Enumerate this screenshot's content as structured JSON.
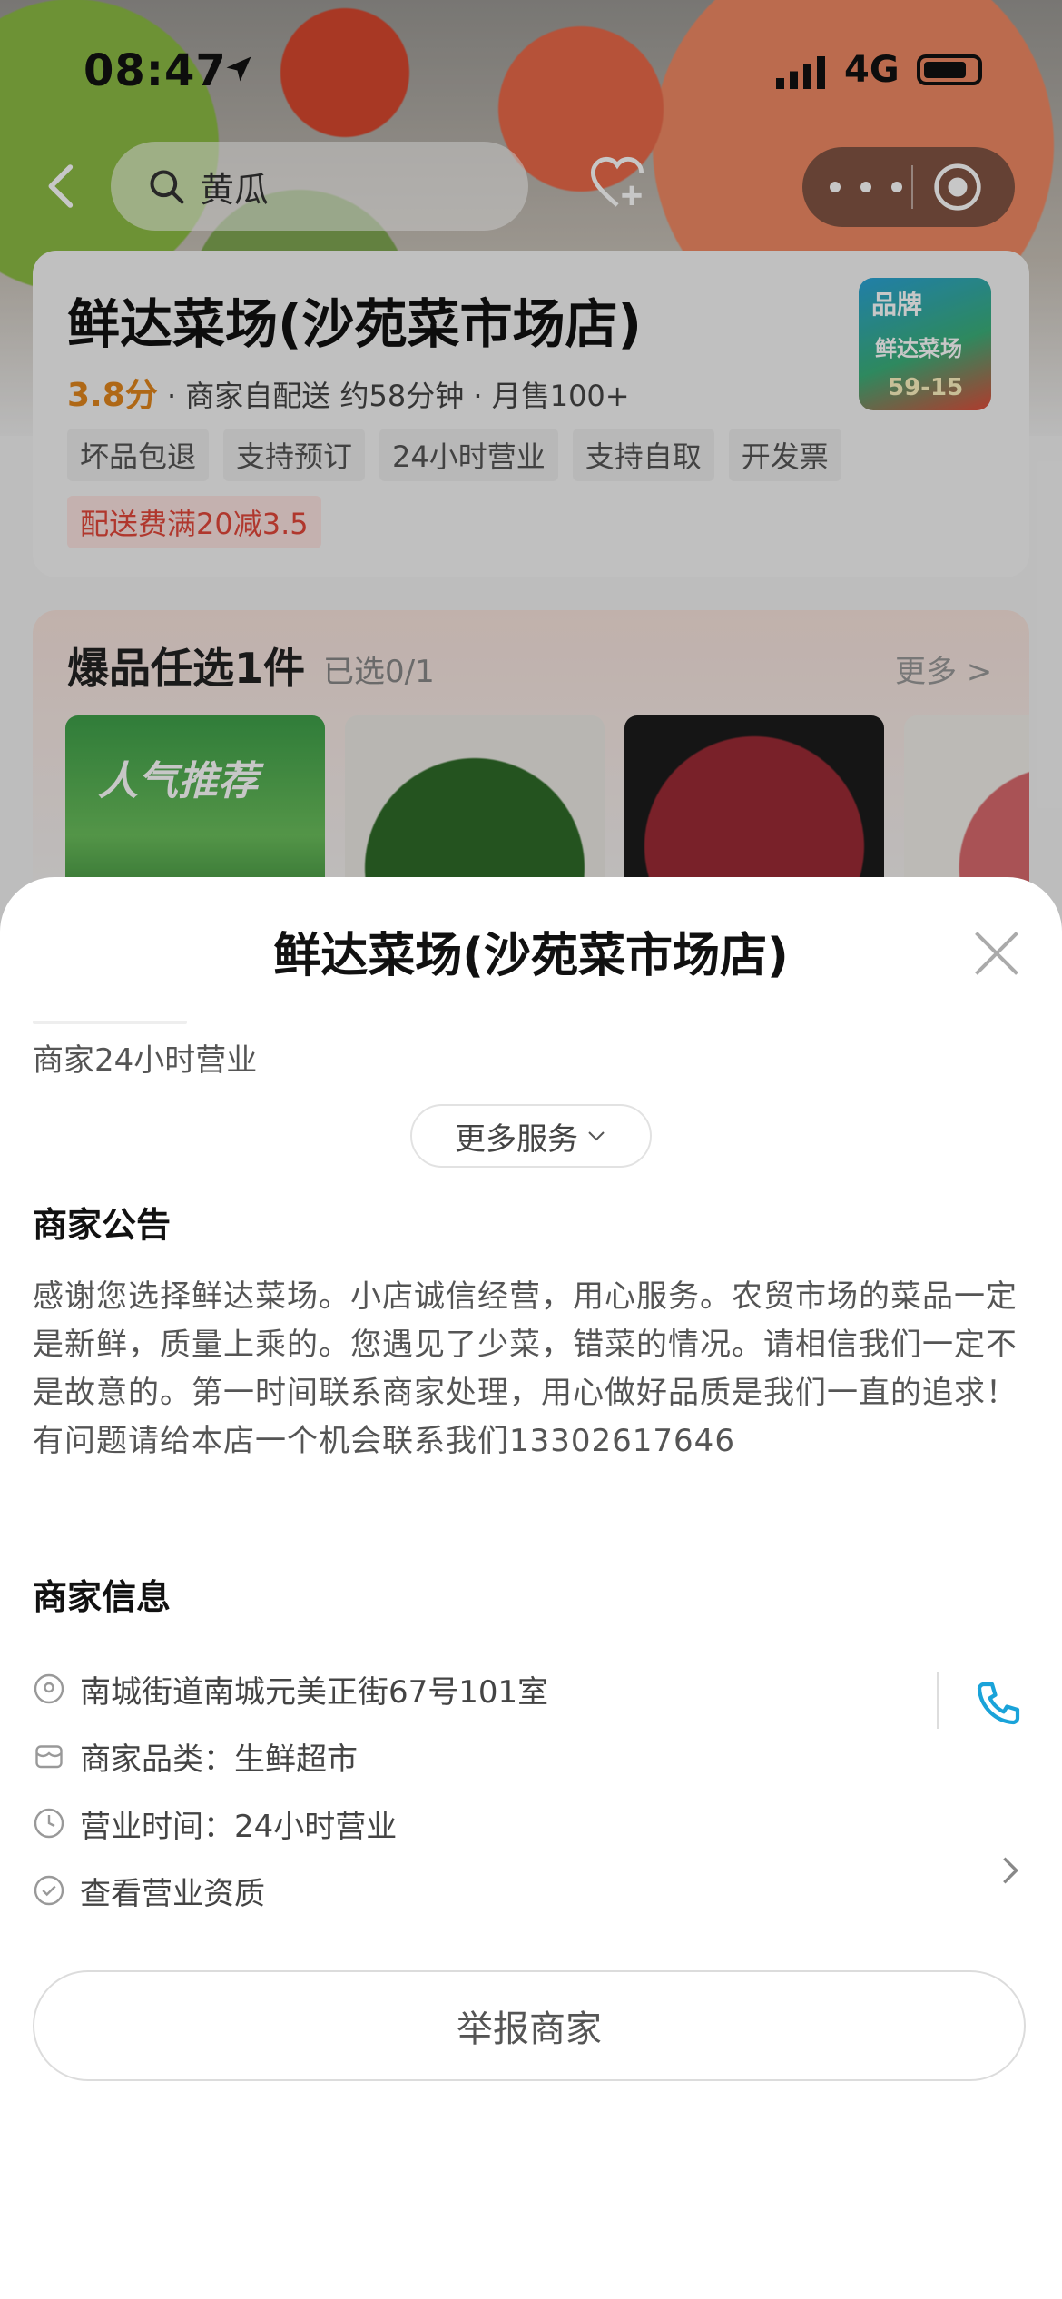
{
  "status_bar": {
    "time": "08:47",
    "network": "4G"
  },
  "nav": {
    "search_value": "黄瓜"
  },
  "store": {
    "name": "鲜达菜场(沙苑菜市场店)",
    "score": "3.8分",
    "meta": "· 商家自配送 约58分钟 · 月售100+",
    "tags": [
      "坏品包退",
      "支持预订",
      "24小时营业",
      "支持自取",
      "开发票"
    ],
    "promo": "配送费满20减3.5",
    "logo": {
      "badge": "品牌",
      "brand": "鲜达菜场",
      "range": "59-15"
    }
  },
  "hot_picks": {
    "title": "爆品任选1件",
    "selected": "已选0/1",
    "more": "更多 >",
    "first_thumb_label": "人气推荐"
  },
  "sheet": {
    "title": "鲜达菜场(沙苑菜市场店)",
    "open_hours_note": "商家24小时营业",
    "more_services": "更多服务",
    "notice_heading": "商家公告",
    "notice_text": "感谢您选择鲜达菜场。小店诚信经营，用心服务。农贸市场的菜品一定是新鲜，质量上乘的。您遇见了少菜，错菜的情况。请相信我们一定不是故意的。第一时间联系商家处理，用心做好品质是我们一直的追求！有问题请给本店一个机会联系我们13302617646",
    "info_heading": "商家信息",
    "address": "南城街道南城元美正街67号101室",
    "category": "商家品类：生鲜超市",
    "business_hours": "营业时间：24小时营业",
    "license_link": "查看营业资质",
    "report_button": "举报商家"
  },
  "colors": {
    "accent_phone": "#1aa3d9",
    "score_orange": "#e0861d",
    "promo_red": "#e2473a"
  }
}
